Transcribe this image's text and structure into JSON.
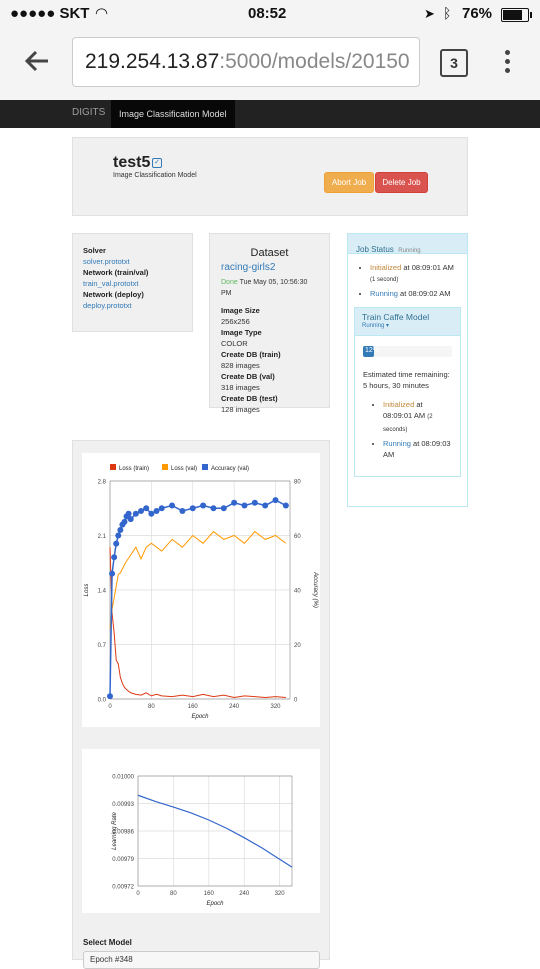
{
  "status_bar": {
    "carrier": "●●●●● SKT",
    "time": "08:52",
    "battery": "76%"
  },
  "browser": {
    "url_host": "219.254.13.87",
    "url_rest": ":5000/models/20150",
    "tab_count": "3"
  },
  "navbar": {
    "brand": "DIGITS",
    "active": "Image Classification Model"
  },
  "header": {
    "title": "test5",
    "subtitle": "Image Classification Model",
    "abort_label": "Abort Job",
    "delete_label": "Delete Job"
  },
  "files": {
    "solver_label": "Solver",
    "solver_file": "solver.prototxt",
    "network_train_label": "Network (train/val)",
    "network_train_file": "train_val.prototxt",
    "network_deploy_label": "Network (deploy)",
    "network_deploy_file": "deploy.prototxt"
  },
  "dataset": {
    "heading": "Dataset",
    "name": "racing-girls2",
    "status": "Done",
    "date": "Tue May 05, 10:56:30 PM",
    "rows": [
      {
        "label": "Image Size",
        "value": "256x256"
      },
      {
        "label": "Image Type",
        "value": "COLOR"
      },
      {
        "label": "Create DB (train)",
        "value": "828 images"
      },
      {
        "label": "Create DB (val)",
        "value": "318 images"
      },
      {
        "label": "Create DB (test)",
        "value": "128 images"
      }
    ]
  },
  "job_status": {
    "title": "Job Status",
    "state": "Running",
    "events": [
      {
        "name": "Initialized",
        "time": "at 08:09:01 AM",
        "extra": "(1 second)"
      },
      {
        "name": "Running",
        "time": "at 08:09:02 AM",
        "extra": ""
      }
    ],
    "task": {
      "title": "Train Caffe Model",
      "state": "Running ▾",
      "progress": 0.12,
      "progress_label": "12%",
      "remaining": "Estimated time remaining: 5 hours, 30 minutes",
      "events": [
        {
          "name": "Initialized",
          "time": "at 08:09:01 AM",
          "extra": "(2 seconds)"
        },
        {
          "name": "Running",
          "time": "at 08:09:03 AM",
          "extra": ""
        }
      ]
    }
  },
  "select_model": {
    "label": "Select Model",
    "value": "Epoch #348"
  },
  "colors": {
    "loss_train": "#dc3912",
    "loss_val": "#ff9900",
    "accuracy": "#3366cc",
    "lr": "#3366cc"
  },
  "chart_data": [
    {
      "type": "line",
      "xlabel": "Epoch",
      "ylabel": "Loss",
      "y2label": "Accuracy (%)",
      "xlim": [
        0,
        348
      ],
      "ylim": [
        0,
        2.8
      ],
      "y2lim": [
        0,
        80
      ],
      "xticks": [
        "0",
        "80",
        "160",
        "240",
        "320"
      ],
      "yticks": [
        "0.0",
        "0.7",
        "1.4",
        "2.1",
        "2.8"
      ],
      "y2ticks": [
        "0",
        "20",
        "40",
        "60",
        "80"
      ],
      "legend": "top",
      "series": [
        {
          "name": "Loss (train)",
          "axis": "left",
          "x": [
            0,
            4,
            8,
            12,
            16,
            20,
            24,
            28,
            32,
            36,
            40,
            50,
            60,
            70,
            80,
            90,
            100,
            120,
            140,
            160,
            180,
            200,
            220,
            240,
            260,
            280,
            300,
            320,
            340
          ],
          "y": [
            1.95,
            1.1,
            0.85,
            0.5,
            0.45,
            0.28,
            0.2,
            0.15,
            0.12,
            0.1,
            0.08,
            0.06,
            0.05,
            0.08,
            0.04,
            0.06,
            0.04,
            0.03,
            0.05,
            0.03,
            0.06,
            0.03,
            0.05,
            0.02,
            0.04,
            0.03,
            0.02,
            0.03,
            0.02
          ]
        },
        {
          "name": "Loss (val)",
          "axis": "left",
          "x": [
            0,
            4,
            8,
            12,
            16,
            20,
            30,
            40,
            50,
            60,
            70,
            80,
            100,
            120,
            140,
            160,
            180,
            200,
            220,
            240,
            260,
            280,
            300,
            320,
            340
          ],
          "y": [
            0.9,
            1.15,
            1.3,
            1.45,
            1.6,
            1.62,
            1.75,
            1.85,
            1.95,
            1.8,
            1.95,
            2.0,
            1.9,
            2.05,
            1.95,
            2.1,
            2.0,
            2.15,
            2.05,
            2.1,
            2.0,
            2.15,
            2.05,
            2.1,
            2.0
          ]
        },
        {
          "name": "Accuracy (val)",
          "axis": "right",
          "x": [
            0,
            4,
            8,
            12,
            16,
            20,
            24,
            28,
            32,
            36,
            40,
            50,
            60,
            70,
            80,
            90,
            100,
            120,
            140,
            160,
            180,
            200,
            220,
            240,
            260,
            280,
            300,
            320,
            340
          ],
          "y": [
            1,
            46,
            52,
            57,
            60,
            62,
            64,
            65,
            67,
            68,
            66,
            68,
            69,
            70,
            68,
            69,
            70,
            71,
            69,
            70,
            71,
            70,
            70,
            72,
            71,
            72,
            71,
            73,
            71
          ]
        }
      ]
    },
    {
      "type": "line",
      "xlabel": "Epoch",
      "ylabel": "Learning Rate",
      "xlim": [
        0,
        348
      ],
      "ylim": [
        0.00972,
        0.01
      ],
      "xticks": [
        "0",
        "80",
        "160",
        "240",
        "320"
      ],
      "yticks": [
        "0.00972",
        "0.00979",
        "0.00986",
        "0.00993",
        "0.01000"
      ],
      "series": [
        {
          "name": "Learning Rate",
          "x": [
            0,
            40,
            80,
            120,
            160,
            200,
            240,
            280,
            320,
            348
          ],
          "y": [
            0.009951,
            0.009935,
            0.009921,
            0.009906,
            0.009888,
            0.009867,
            0.009843,
            0.009817,
            0.009788,
            0.009768
          ]
        }
      ]
    }
  ]
}
